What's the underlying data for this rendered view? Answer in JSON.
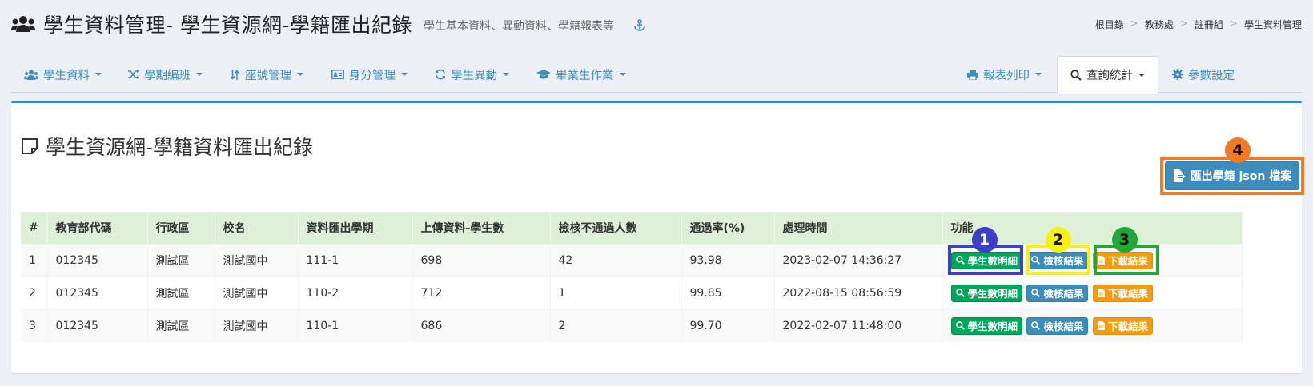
{
  "header": {
    "title": "學生資料管理- 學生資源網-學籍匯出紀錄",
    "subtitle": "學生基本資料、異動資料、學籍報表等",
    "icon": "users-icon"
  },
  "breadcrumb": [
    "根目錄",
    "教務處",
    "註冊組",
    "學生資料管理"
  ],
  "nav": {
    "left": [
      {
        "label": "學生資料",
        "icon": "users-icon"
      },
      {
        "label": "學期編班",
        "icon": "shuffle-icon"
      },
      {
        "label": "座號管理",
        "icon": "sort-icon"
      },
      {
        "label": "身分管理",
        "icon": "id-card-icon"
      },
      {
        "label": "學生異動",
        "icon": "sync-icon"
      },
      {
        "label": "畢業生作業",
        "icon": "graduation-cap-icon"
      }
    ],
    "right": [
      {
        "label": "報表列印",
        "icon": "print-icon"
      },
      {
        "label": "查詢統計",
        "icon": "search-icon",
        "active": true
      },
      {
        "label": "參數設定",
        "icon": "gear-icon"
      }
    ]
  },
  "box": {
    "title": "學生資源網-學籍資料匯出紀錄",
    "export_button": "匯出學籍 json 檔案"
  },
  "table": {
    "columns": [
      "#",
      "教育部代碼",
      "行政區",
      "校名",
      "資料匯出學期",
      "上傳資料-學生數",
      "檢核不通過人數",
      "通過率(%)",
      "處理時間",
      "功能"
    ],
    "rows": [
      {
        "no": "1",
        "code": "012345",
        "district": "測試區",
        "school": "測試國中",
        "term": "111-1",
        "students": "698",
        "failed": "42",
        "rate": "93.98",
        "time": "2023-02-07 14:36:27"
      },
      {
        "no": "2",
        "code": "012345",
        "district": "測試區",
        "school": "測試國中",
        "term": "110-2",
        "students": "712",
        "failed": "1",
        "rate": "99.85",
        "time": "2022-08-15 08:56:59"
      },
      {
        "no": "3",
        "code": "012345",
        "district": "測試區",
        "school": "測試國中",
        "term": "110-1",
        "students": "686",
        "failed": "2",
        "rate": "99.70",
        "time": "2022-02-07 11:48:00"
      }
    ],
    "actions": {
      "detail": "學生數明細",
      "check": "檢核結果",
      "download": "下載結果"
    }
  },
  "annotations": {
    "badges": [
      "1",
      "2",
      "3",
      "4"
    ],
    "colors": {
      "1": "#3b3fc9",
      "2": "#f7ef1a",
      "3": "#22a63a",
      "4": "#f07b24"
    }
  }
}
